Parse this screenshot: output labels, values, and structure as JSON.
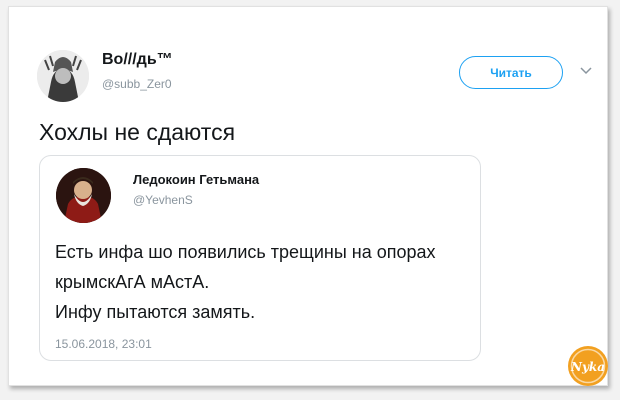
{
  "tweet": {
    "author_name": "Во///дь™",
    "author_handle": "@subb_Zer0",
    "follow_label": "Читать",
    "text": "Хохлы не сдаются"
  },
  "quoted": {
    "author_name": "Ледокоин Гетьмана",
    "author_handle": "@YevhenS",
    "lines": [
      "Есть инфа шо появились трещины на опорах",
      "крымскАгА мАстА.",
      "Инфу пытаются замять."
    ],
    "timestamp": "15.06.2018, 23:01"
  },
  "watermark": {
    "text": "Nykа"
  },
  "colors": {
    "accent": "#1da1f2",
    "text": "#14171a",
    "secondary_text": "#8a959e",
    "watermark": "#f2a020"
  },
  "icons": {
    "author_avatar": "author-avatar",
    "follow_menu": "chevron-down-icon",
    "quoted_avatar": "quoted-author-avatar",
    "watermark_logo": "watermark-logo"
  }
}
